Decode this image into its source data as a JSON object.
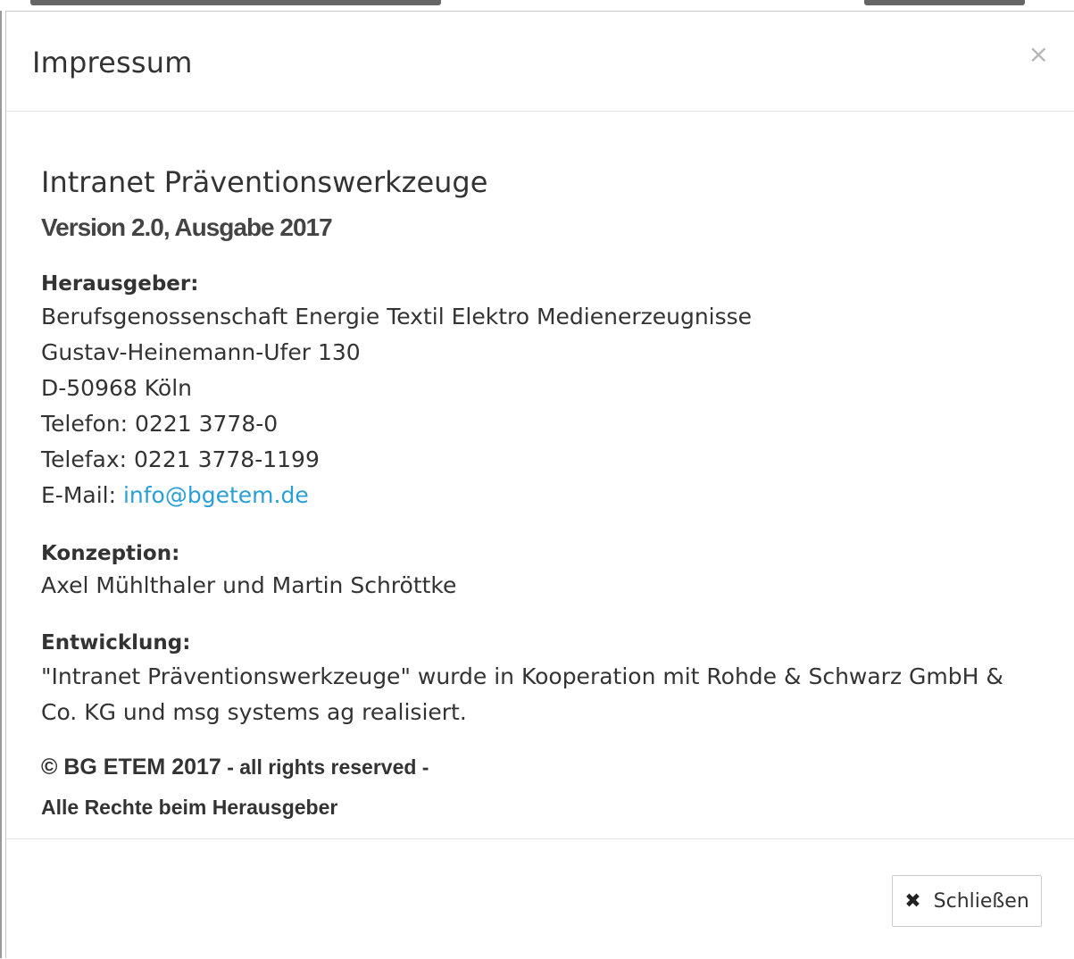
{
  "modal": {
    "title": "Impressum",
    "close_icon": "×"
  },
  "body": {
    "app_name": "Intranet Präventionswerkzeuge",
    "version": "Version 2.0, Ausgabe 2017",
    "publisher": {
      "heading": "Herausgeber:",
      "organization": "Berufsgenossenschaft Energie Textil Elektro Medienerzeugnisse",
      "street": "Gustav-Heinemann-Ufer 130",
      "city": "D-50968 Köln",
      "phone": "Telefon: 0221 3778-0",
      "fax": "Telefax: 0221 3778-1199",
      "email_label": "E-Mail: ",
      "email": "info@bgetem.de"
    },
    "concept": {
      "heading": "Konzeption:",
      "text": "Axel Mühlthaler und Martin Schröttke"
    },
    "development": {
      "heading": "Entwicklung:",
      "text": "\"Intranet Präventionswerkzeuge\" wurde in Kooperation mit Rohde & Schwarz GmbH & Co. KG und msg systems ag realisiert."
    },
    "copyright": {
      "main": "© BG ETEM 2017",
      "suffix": " - all rights reserved -",
      "line2": "Alle Rechte beim Herausgeber"
    }
  },
  "footer": {
    "close_icon": "✖",
    "close_label": "Schließen"
  },
  "colors": {
    "link": "#2a9fd6",
    "text": "#333333",
    "close_x": "#b5b5b5"
  }
}
